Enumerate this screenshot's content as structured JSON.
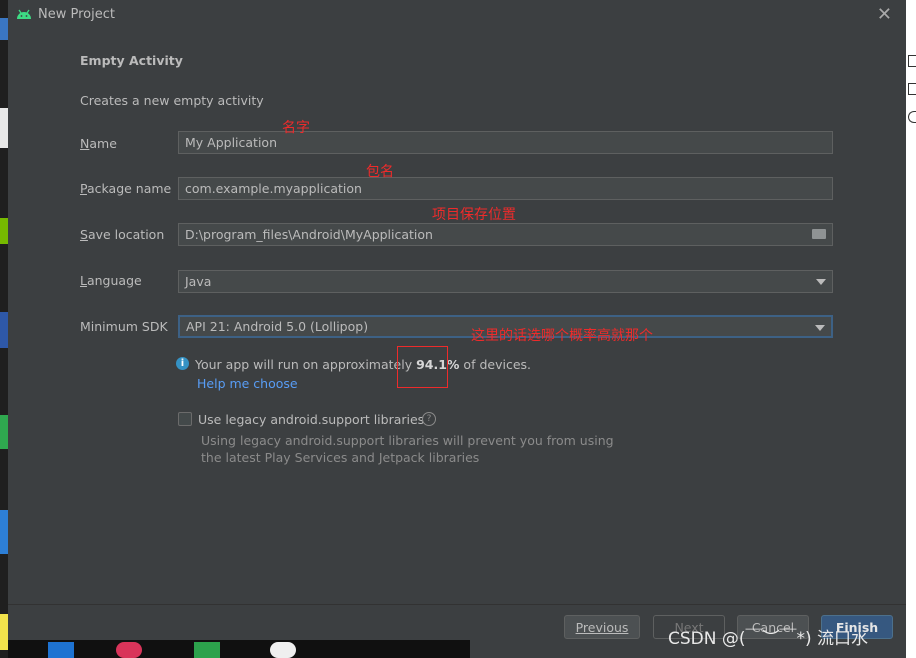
{
  "window": {
    "title": "New Project",
    "close_glyph": "✕"
  },
  "page": {
    "heading": "Empty Activity",
    "description": "Creates a new empty activity"
  },
  "form": {
    "name": {
      "label_first": "N",
      "label_rest": "ame",
      "value": "My Application"
    },
    "package": {
      "label_first": "P",
      "label_rest": "ackage name",
      "value": "com.example.myapplication"
    },
    "location": {
      "label_first": "S",
      "label_rest": "ave location",
      "value": "D:\\program_files\\Android\\MyApplication"
    },
    "language": {
      "label_first": "L",
      "label_rest": "anguage",
      "value": "Java"
    },
    "sdk": {
      "label": "Minimum SDK",
      "value": "API 21: Android 5.0 (Lollipop)"
    }
  },
  "info": {
    "icon": "i",
    "prefix": "Your app will run on approximately ",
    "percent": "94.1%",
    "suffix": " of devices.",
    "help_link": "Help me choose"
  },
  "legacy": {
    "label": "Use legacy android.support libraries",
    "checked": false,
    "help_glyph": "?",
    "note1": "Using legacy android.support libraries will prevent you from using",
    "note2": "the latest Play Services and Jetpack libraries"
  },
  "buttons": {
    "previous": "Previous",
    "next": "Next",
    "cancel": "Cancel",
    "finish": "Finish"
  },
  "annotations": {
    "name": "名字",
    "package": "包名",
    "location": "项目保存位置",
    "sdk": "这里的话选哪个概率高就那个"
  },
  "watermark": "CSDN @(￣︶￣*) 流口水",
  "colors": {
    "accent": "#365880",
    "link": "#589df6",
    "annotation": "#ee2b2b",
    "background": "#3c3f41"
  }
}
